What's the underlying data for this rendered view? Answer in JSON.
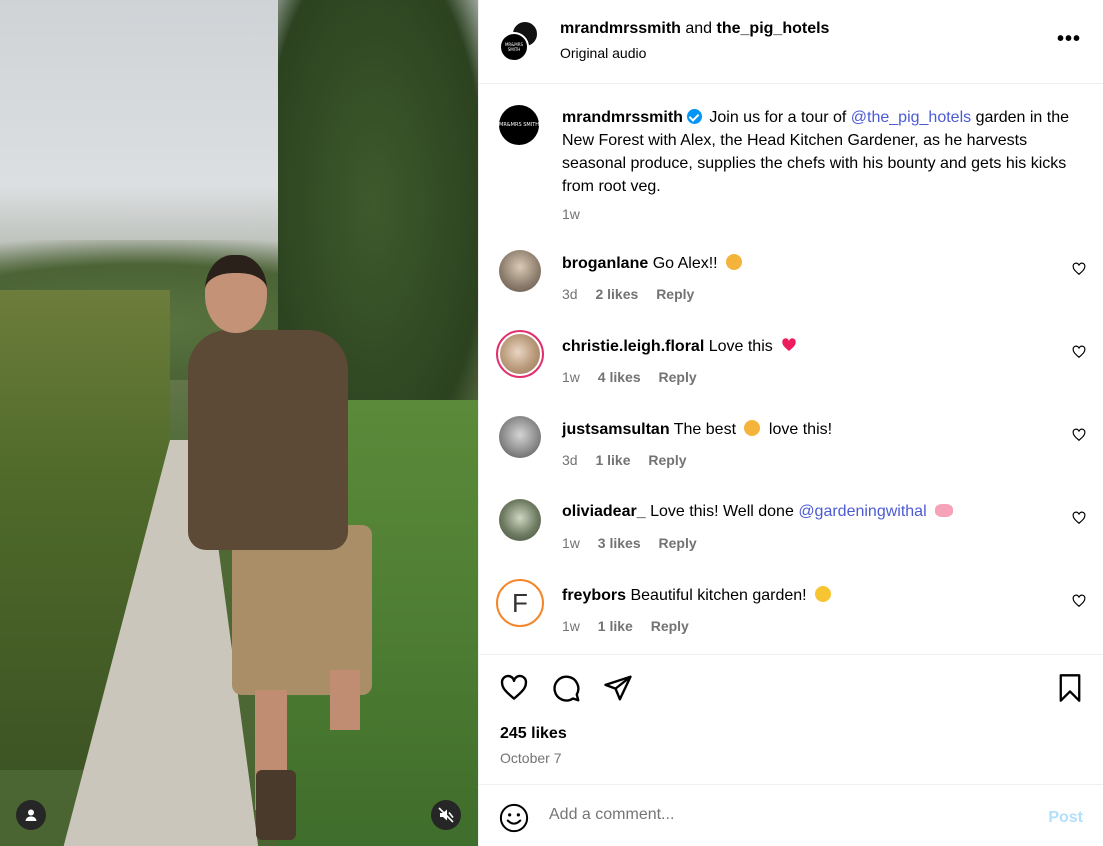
{
  "media": {
    "controls": {
      "profile_icon": "person-icon",
      "mute_icon": "speaker-muted-icon"
    }
  },
  "header": {
    "author1": "mrandmrssmith",
    "connector": "and",
    "author2": "the_pig_hotels",
    "audio": "Original audio",
    "more": "•••",
    "logo_text": "MR&MRS SMITH"
  },
  "caption": {
    "username": "mrandmrssmith",
    "before_mention": "Join us for a tour of",
    "mention": "@the_pig_hotels",
    "after_mention": "garden in the New Forest with Alex, the Head Kitchen Gardener, as he harvests seasonal produce, supplies the chefs with his bounty and gets his kicks from root veg.",
    "time": "1w"
  },
  "comments": [
    {
      "username": "broganlane",
      "text": "Go Alex!!",
      "emoji": "clapping-hands",
      "time": "3d",
      "likes": "2 likes",
      "reply": "Reply"
    },
    {
      "username": "christie.leigh.floral",
      "text": "Love this",
      "emoji": "heart",
      "time": "1w",
      "likes": "4 likes",
      "reply": "Reply"
    },
    {
      "username": "justsamsultan",
      "text_before": "The best",
      "emoji": "clapping-hands",
      "text_after": "love this!",
      "time": "3d",
      "likes": "1 like",
      "reply": "Reply"
    },
    {
      "username": "oliviadear_",
      "text": "Love this! Well done",
      "mention": "@gardeningwithal",
      "emoji": "pig",
      "time": "1w",
      "likes": "3 likes",
      "reply": "Reply"
    },
    {
      "username": "freybors",
      "text": "Beautiful kitchen garden!",
      "emoji": "heart-eyes",
      "time": "1w",
      "likes": "1 like",
      "reply": "Reply",
      "avatar_letter": "F"
    }
  ],
  "actions": {
    "likes": "245 likes",
    "date": "October 7"
  },
  "add_comment": {
    "placeholder": "Add a comment...",
    "post_label": "Post"
  },
  "colors": {
    "mention": "#4c5bd4",
    "muted_text": "#737373",
    "verified": "#0095f6",
    "post_disabled": "#b2dffc",
    "heart_emoji": "#ed1c5c"
  }
}
